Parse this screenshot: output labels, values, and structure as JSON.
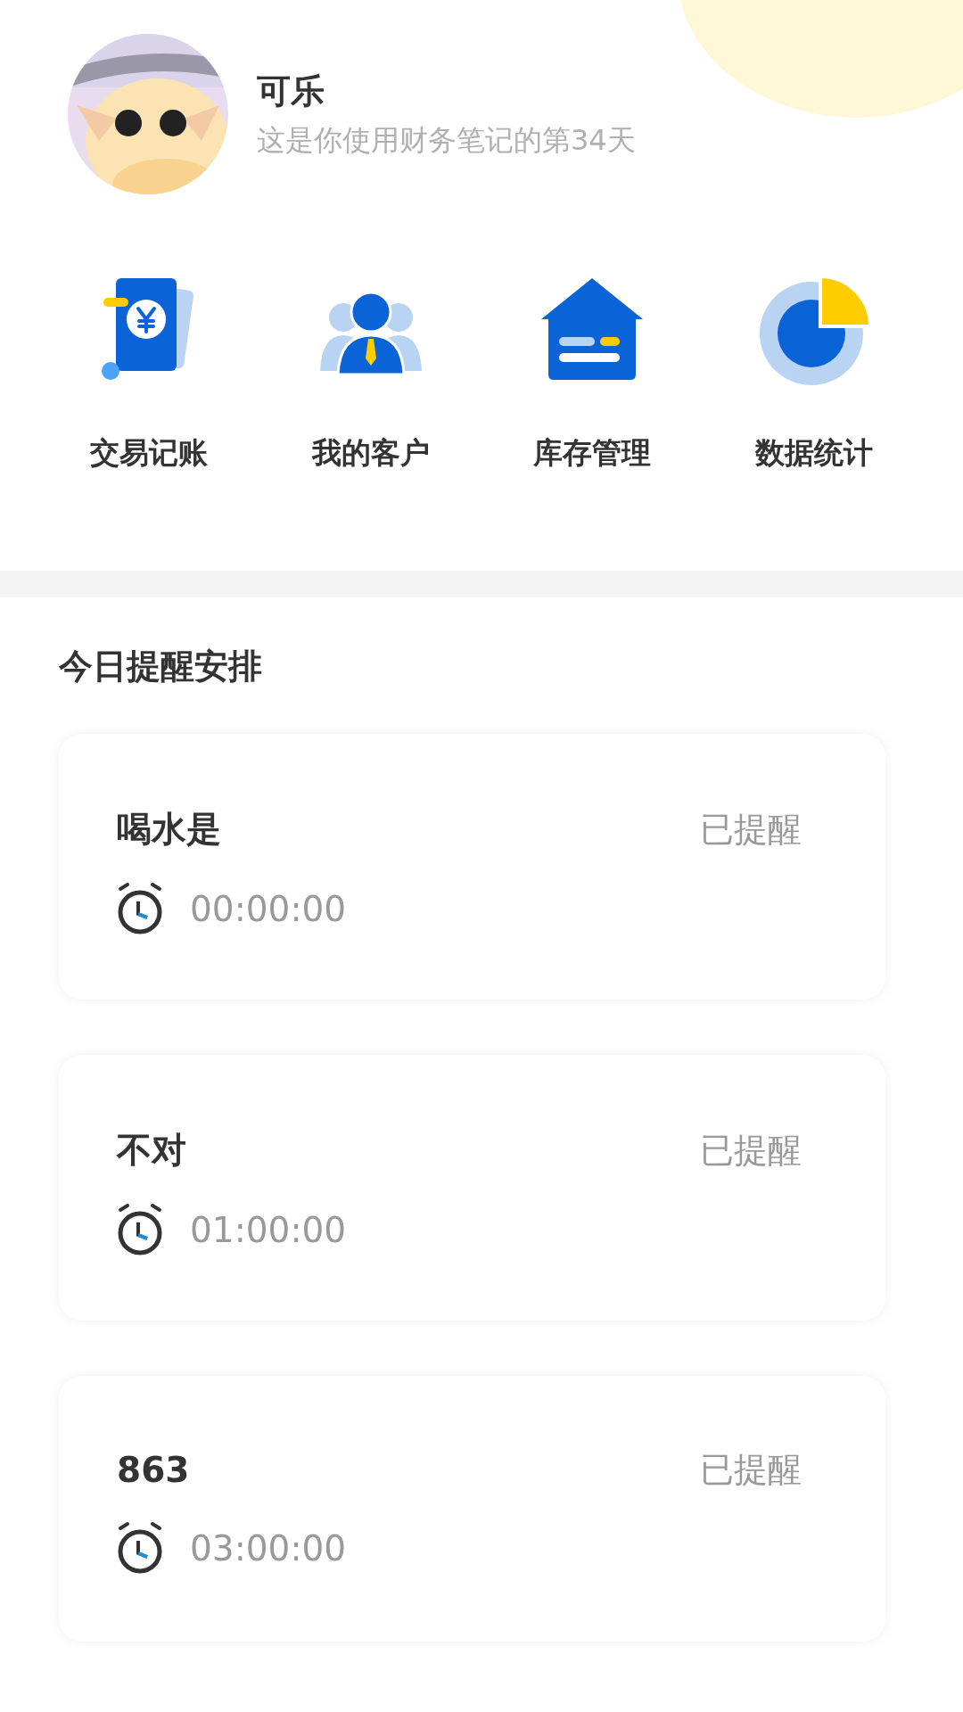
{
  "profile": {
    "name": "可乐",
    "subtitle": "这是你使用财务笔记的第34天"
  },
  "shortcuts": [
    {
      "kind": "ledger",
      "label": "交易记账"
    },
    {
      "kind": "customers",
      "label": "我的客户"
    },
    {
      "kind": "inventory",
      "label": "库存管理"
    },
    {
      "kind": "statistics",
      "label": "数据统计"
    }
  ],
  "section_title": "今日提醒安排",
  "reminders": [
    {
      "title": "喝水是",
      "status": "已提醒",
      "time": "00:00:00"
    },
    {
      "title": "不对",
      "status": "已提醒",
      "time": "01:00:00"
    },
    {
      "title": "863",
      "status": "已提醒",
      "time": "03:00:00"
    }
  ]
}
